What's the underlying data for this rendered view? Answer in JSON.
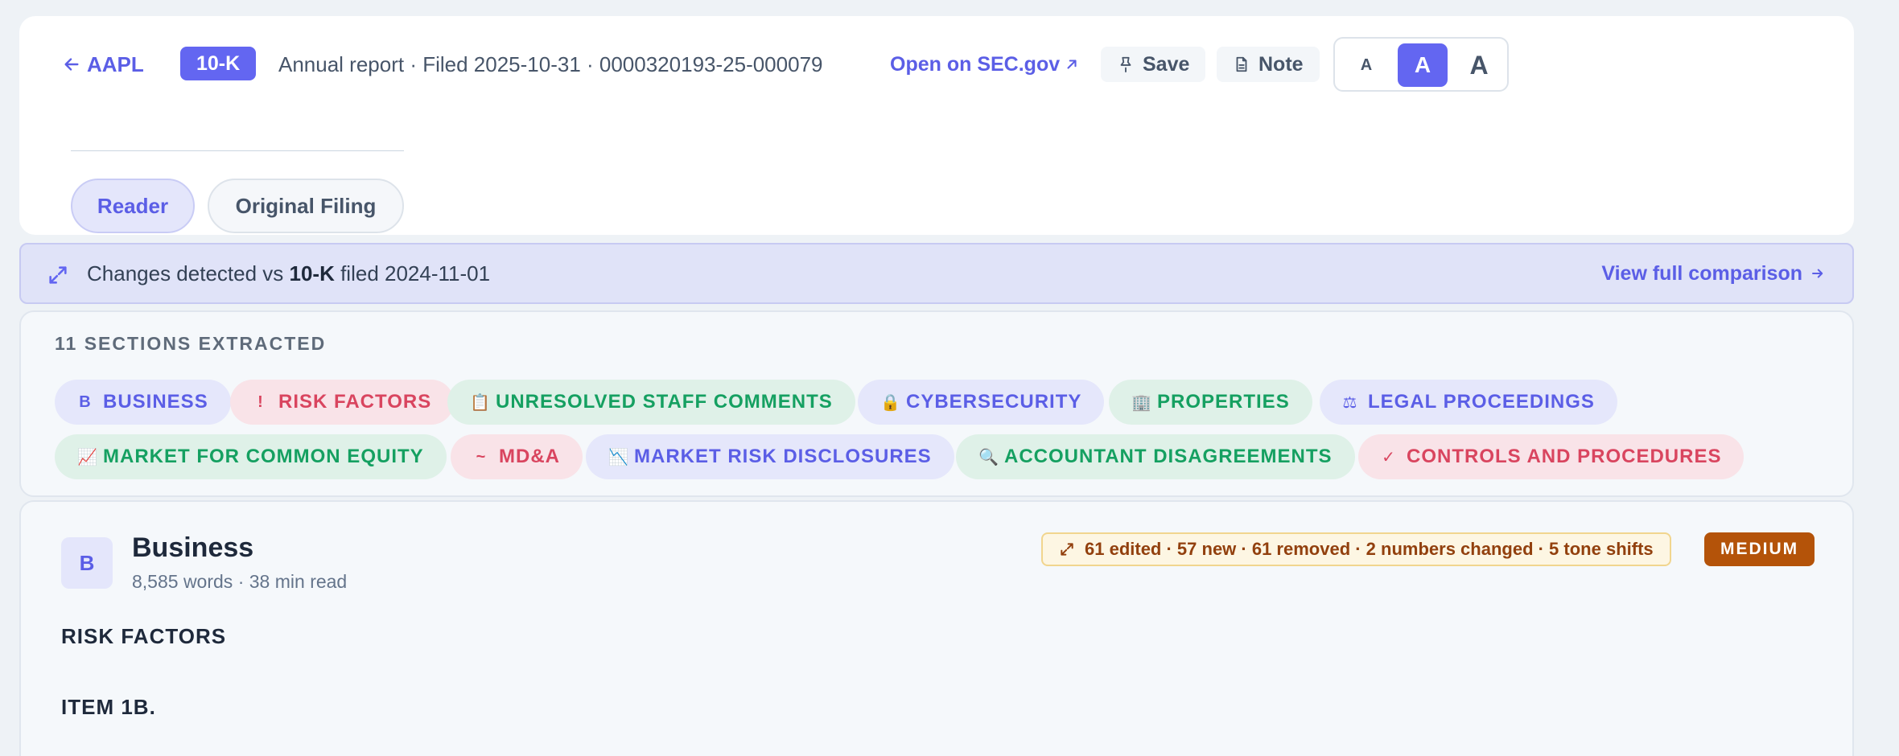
{
  "header": {
    "back_label": "AAPL",
    "form_type": "10-K",
    "filing_meta": "Annual report · Filed 2025-10-31 · 0000320193-25-000079",
    "sec_link_label": "Open on SEC.gov",
    "save_label": "Save",
    "note_label": "Note",
    "font_sizes": [
      "A",
      "A",
      "A"
    ],
    "selected_font_size": 1
  },
  "tabs": [
    {
      "label": "Reader",
      "active": true
    },
    {
      "label": "Original Filing",
      "active": false
    }
  ],
  "change_banner": {
    "prefix": "Changes detected vs ",
    "form": "10-K",
    "suffix": " filed 2024-11-01",
    "link_label": "View full comparison"
  },
  "sections": {
    "title": "11 SECTIONS EXTRACTED",
    "items": [
      {
        "icon": "B",
        "label": "BUSINESS",
        "color": "purple"
      },
      {
        "icon": "!",
        "label": "RISK FACTORS",
        "color": "pink"
      },
      {
        "icon": "📋",
        "label": "UNRESOLVED STAFF COMMENTS",
        "color": "green"
      },
      {
        "icon": "🔒",
        "label": "CYBERSECURITY",
        "color": "purple"
      },
      {
        "icon": "🏢",
        "label": "PROPERTIES",
        "color": "green"
      },
      {
        "icon": "⚖",
        "label": "LEGAL PROCEEDINGS",
        "color": "purple"
      },
      {
        "icon": "📈",
        "label": "MARKET FOR COMMON EQUITY",
        "color": "green"
      },
      {
        "icon": "~",
        "label": "MD&A",
        "color": "pink"
      },
      {
        "icon": "📉",
        "label": "MARKET RISK DISCLOSURES",
        "color": "purple"
      },
      {
        "icon": "🔍",
        "label": "ACCOUNTANT DISAGREEMENTS",
        "color": "green"
      },
      {
        "icon": "✓",
        "label": "CONTROLS AND PROCEDURES",
        "color": "pink"
      }
    ]
  },
  "business": {
    "letter": "B",
    "title": "Business",
    "words": "8,585 words",
    "read_time": "38 min read",
    "diff_summary": "61 edited · 57 new · 61 removed · 2 numbers changed · 5 tone shifts",
    "severity": "MEDIUM",
    "headings": [
      "RISK FACTORS",
      "ITEM 1B."
    ]
  },
  "colors": {
    "accent": "#6366f1",
    "pink": "#d9455f",
    "green": "#15a061",
    "severity": "#b45309"
  }
}
